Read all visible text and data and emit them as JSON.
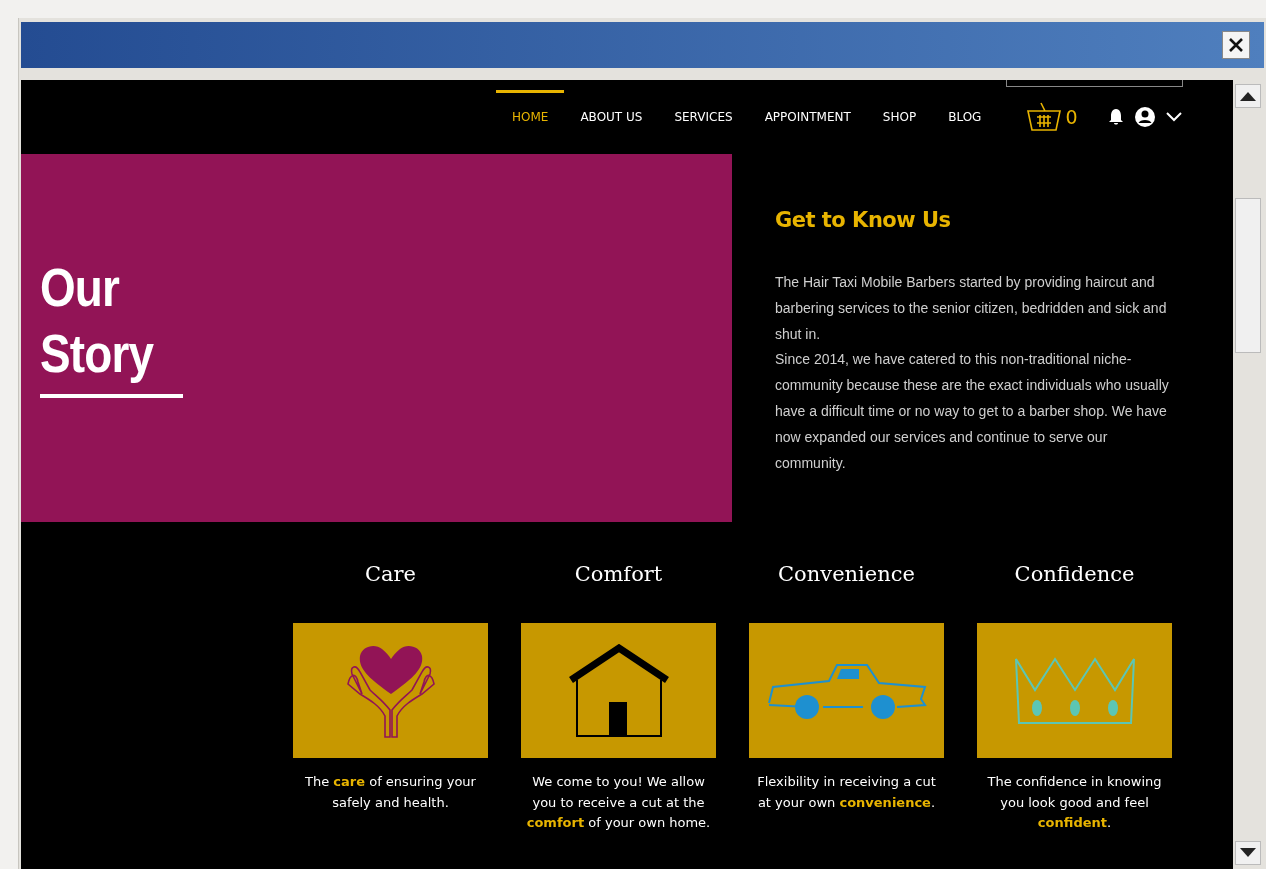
{
  "nav": {
    "items": [
      {
        "label": "HOME",
        "selected": true
      },
      {
        "label": "ABOUT US",
        "selected": false
      },
      {
        "label": "SERVICES",
        "selected": false
      },
      {
        "label": "APPOINTMENT",
        "selected": false
      },
      {
        "label": "SHOP",
        "selected": false
      },
      {
        "label": "BLOG",
        "selected": false
      }
    ],
    "cart_count": "0"
  },
  "hero": {
    "title": "Our Story",
    "heading": "Get to Know Us",
    "paragraphs": [
      "The Hair Taxi Mobile Barbers started by providing haircut and barbering services to the senior citizen, bedridden and sick and shut in.",
      "Since 2014, we have catered to this non-traditional niche-community because these are the exact individuals who usually have a difficult time or no way to get to a barber shop. We have now expanded our services and continue to serve our community."
    ]
  },
  "features": [
    {
      "title": "Care",
      "text": "The **care** of ensuring your safely and health."
    },
    {
      "title": "Comfort",
      "text": "We come to you! We allow you to receive a cut at the **comfort** of your own home."
    },
    {
      "title": "Convenience",
      "text": "Flexibility in receiving a cut at your own **convenience**."
    },
    {
      "title": "Confidence",
      "text": "The confidence in knowing you look good and feel **confident**."
    }
  ]
}
